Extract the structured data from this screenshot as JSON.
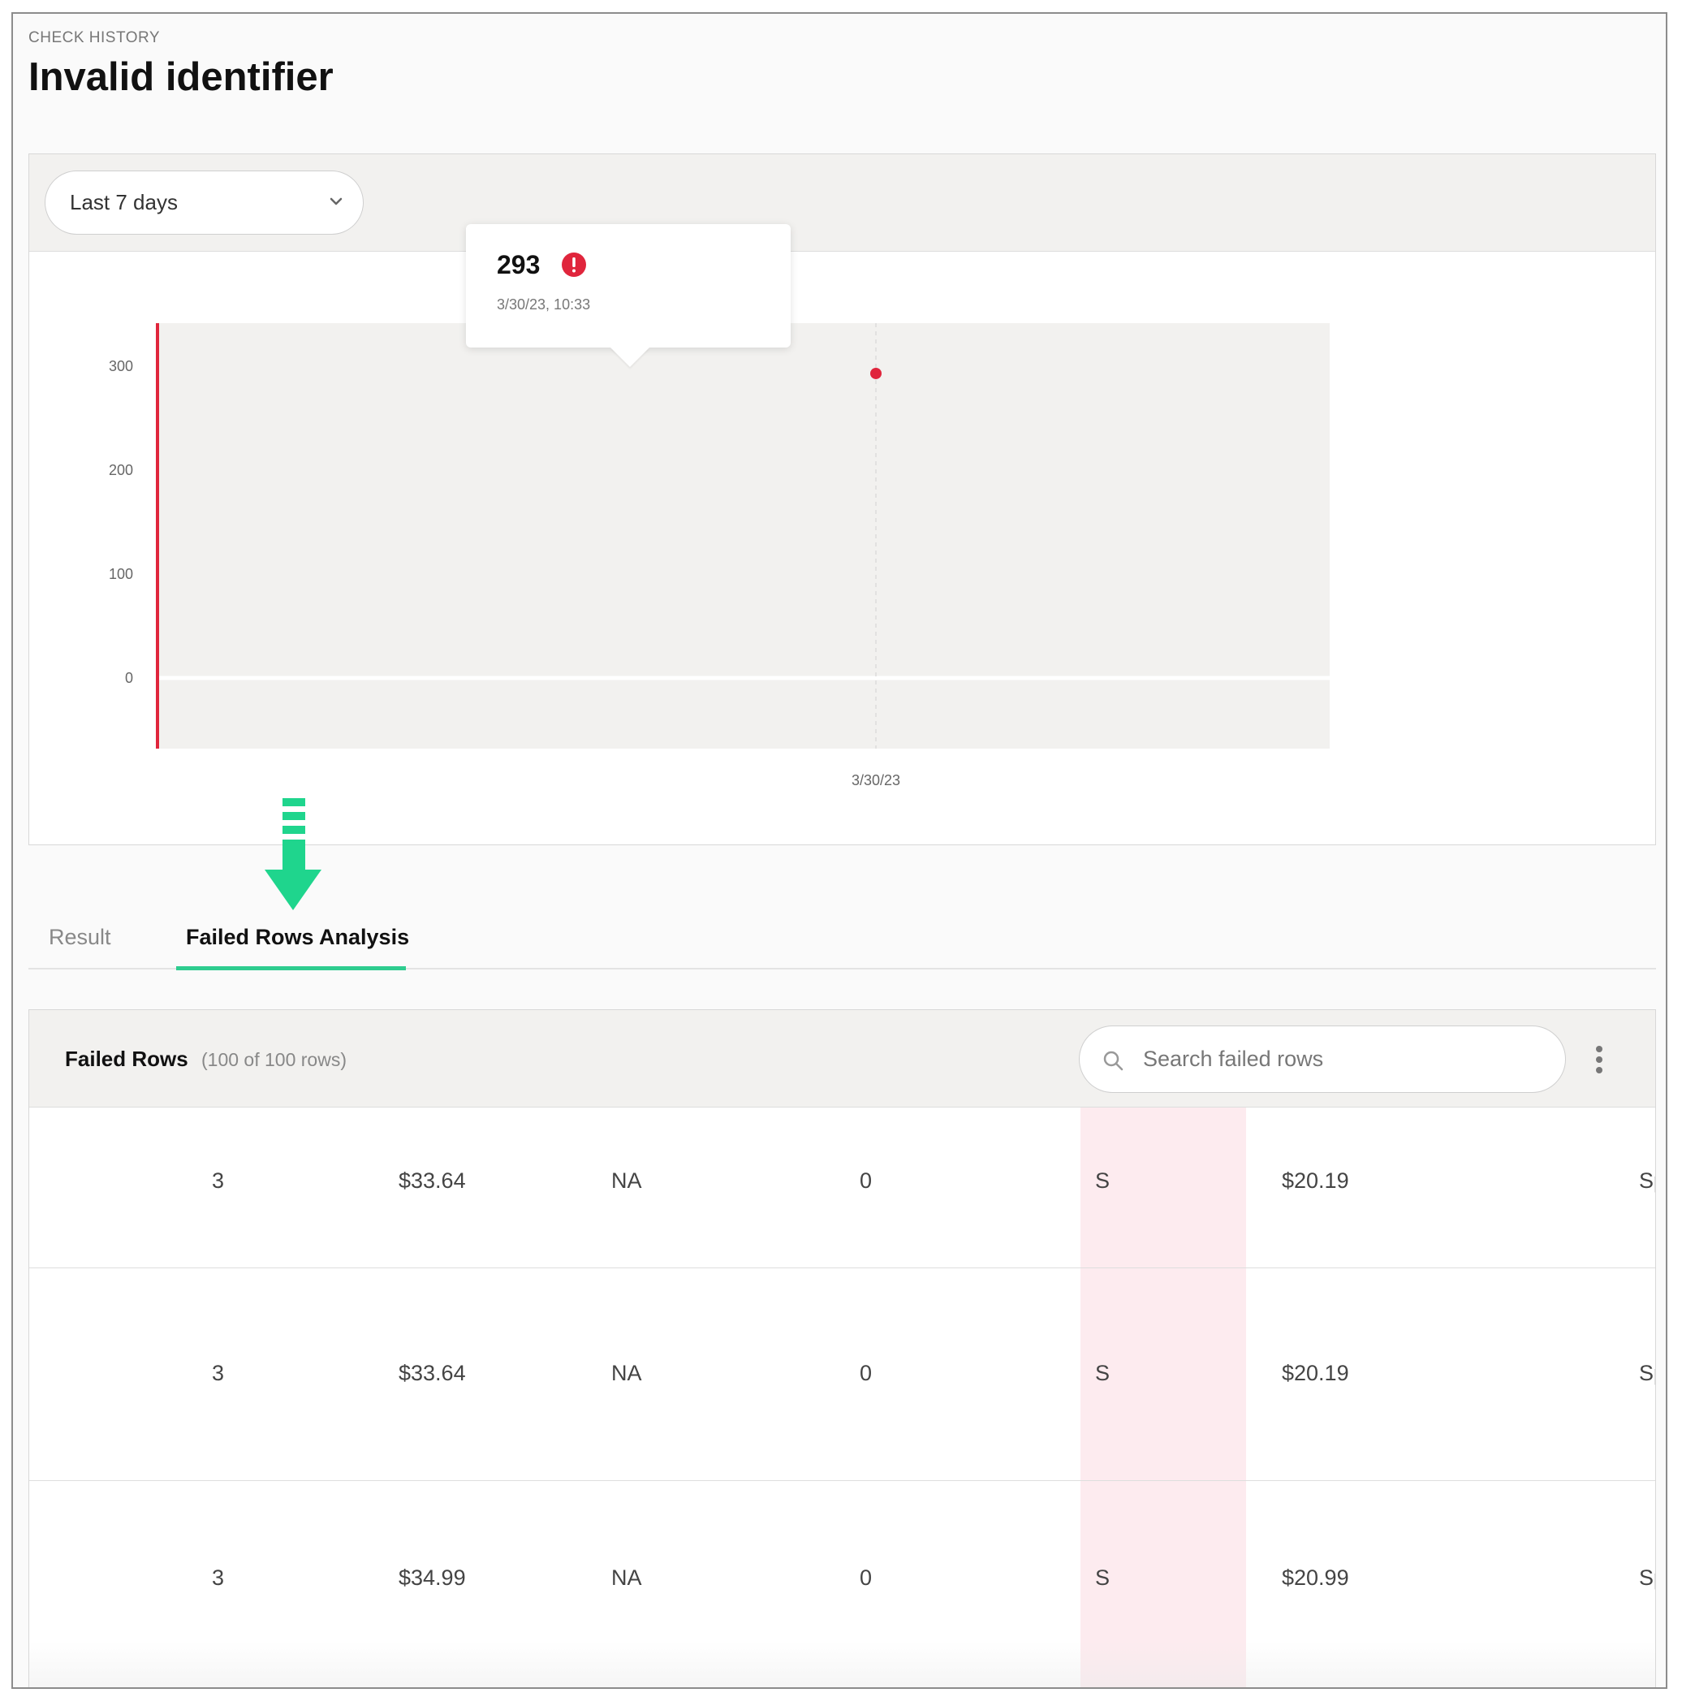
{
  "header": {
    "eyebrow": "CHECK HISTORY",
    "title": "Invalid identifier"
  },
  "filter": {
    "selected": "Last 7 days",
    "icon": "chevron-down-icon"
  },
  "tooltip": {
    "value": "293",
    "time": "3/30/23, 10:33",
    "icon": "alert-icon"
  },
  "chart_data": {
    "type": "scatter",
    "x": [
      "3/30/23"
    ],
    "y": [
      293
    ],
    "xlabel": "",
    "ylabel": "",
    "y_ticks": [
      "300",
      "200",
      "100",
      "0"
    ],
    "x_ticks": [
      "3/30/23"
    ],
    "ylim": [
      -60,
      350
    ],
    "grid": false,
    "colors": {
      "point": "#e0253c",
      "axis": "#e0253c",
      "plot_bg": "#f2f1ef"
    }
  },
  "tabs": [
    {
      "label": "Result",
      "active": false
    },
    {
      "label": "Failed Rows Analysis",
      "active": true
    }
  ],
  "failed_rows": {
    "title": "Failed Rows",
    "count": "(100 of 100 rows)",
    "search_placeholder": "Search failed rows",
    "rows": [
      [
        "3",
        "$33.64",
        "NA",
        "0",
        "S",
        "$20.19",
        "Sp"
      ],
      [
        "3",
        "$33.64",
        "NA",
        "0",
        "S",
        "$20.19",
        "Sp"
      ],
      [
        "3",
        "$34.99",
        "NA",
        "0",
        "S",
        "$20.99",
        "Sp"
      ]
    ]
  },
  "colors": {
    "accent": "#2ecc8f",
    "error": "#e0253c",
    "highlight": "#fdebef"
  }
}
